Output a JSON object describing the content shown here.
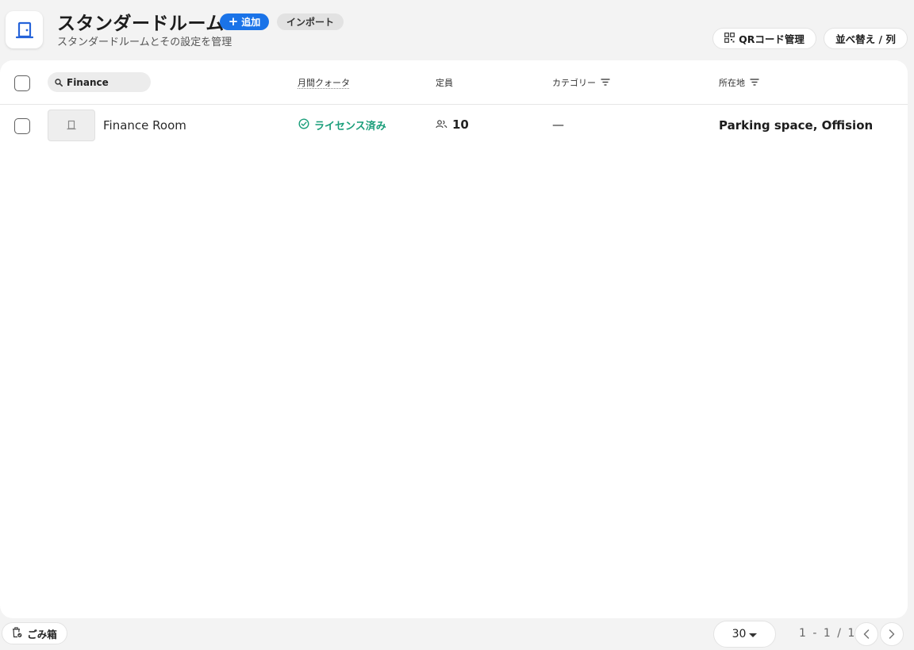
{
  "header": {
    "title": "スタンダードルーム",
    "subtitle": "スタンダードルームとその設定を管理",
    "add_label": "追加",
    "import_label": "インポート",
    "qr_label": "QRコード管理",
    "sort_label": "並べ替え / 列",
    "accent_color": "#1a73e8"
  },
  "table": {
    "search_value": "Finance",
    "columns": {
      "quota": "月間クォータ",
      "capacity": "定員",
      "category": "カテゴリー",
      "location": "所在地"
    },
    "rows": [
      {
        "name": "Finance Room",
        "license": "ライセンス済み",
        "capacity": "10",
        "category": "—",
        "location": "Parking space, Offision"
      }
    ],
    "license_color": "#1a9e7a"
  },
  "footer": {
    "trash_label": "ごみ箱",
    "per_page": "30",
    "range": "1 - 1 / 1"
  }
}
